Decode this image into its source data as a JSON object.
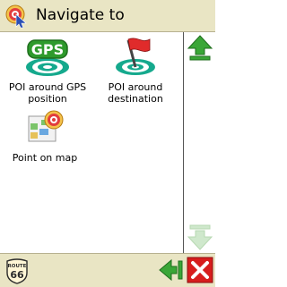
{
  "header": {
    "title": "Navigate to"
  },
  "options": [
    {
      "label_line1": "POI around GPS",
      "label_line2": "position"
    },
    {
      "label_line1": "POI around",
      "label_line2": "destination"
    },
    {
      "label_line1": "Point on map"
    }
  ],
  "footer": {
    "logo_text_top": "ROUTE",
    "logo_text_num": "66"
  },
  "icons": {
    "header": "navigate-target-icon",
    "gps": "gps-poi-icon",
    "destination": "destination-poi-icon",
    "map": "map-point-icon",
    "scroll_up": "arrow-up-icon",
    "scroll_down": "arrow-down-icon",
    "back": "back-arrow-icon",
    "close": "close-icon"
  },
  "colors": {
    "bar_bg": "#e9e5c4",
    "green_arrow": "#3aa637",
    "close_red": "#d71d1d"
  }
}
